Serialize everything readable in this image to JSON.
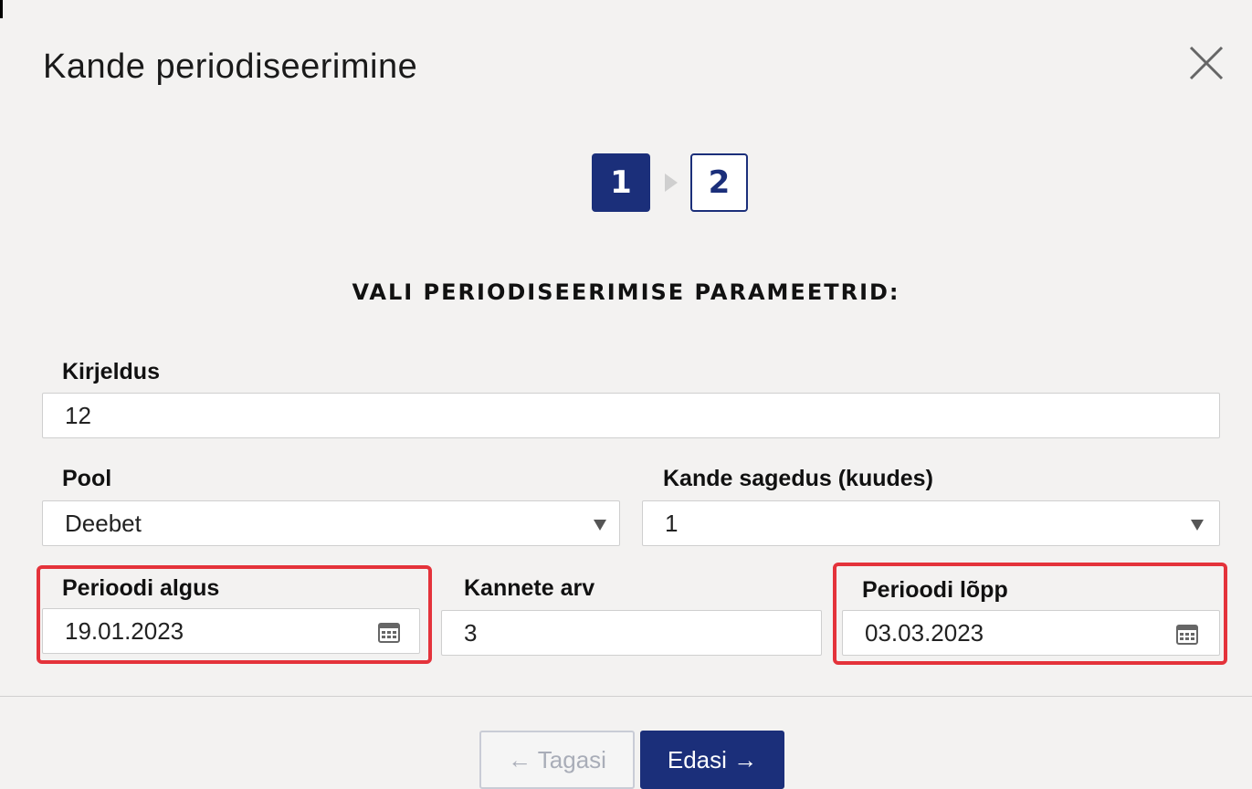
{
  "dialog": {
    "title": "Kande periodiseerimine"
  },
  "steps": [
    {
      "label": "1",
      "state": "active"
    },
    {
      "label": "2",
      "state": "pending"
    }
  ],
  "section_heading": "VALI PERIODISEERIMISE PARAMEETRID:",
  "form": {
    "kirjeldus": {
      "label": "Kirjeldus",
      "value": "12"
    },
    "pool": {
      "label": "Pool",
      "value": "Deebet"
    },
    "sagedus": {
      "label": "Kande sagedus (kuudes)",
      "value": "1"
    },
    "algus": {
      "label": "Perioodi algus",
      "value": "19.01.2023"
    },
    "kannete_arv": {
      "label": "Kannete arv",
      "value": "3"
    },
    "lopp": {
      "label": "Perioodi lõpp",
      "value": "03.03.2023"
    }
  },
  "buttons": {
    "back": "← Tagasi",
    "next": "Edasi →"
  },
  "colors": {
    "primary": "#1b2f7a",
    "highlight": "#e4333b",
    "background": "#f3f2f1"
  },
  "icons": {
    "close": "close-icon",
    "calendar": "calendar-icon",
    "caret": "chevron-down-icon",
    "step_arrow": "triangle-right-icon"
  }
}
